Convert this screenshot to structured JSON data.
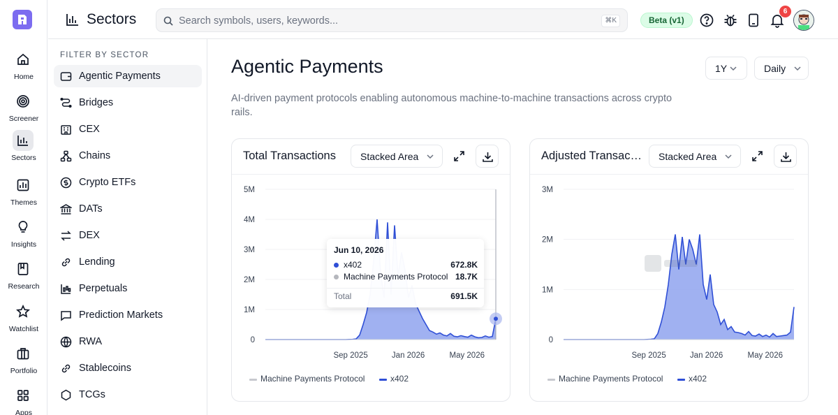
{
  "header": {
    "title": "Sectors",
    "search_placeholder": "Search symbols, users, keywords...",
    "search_shortcut": "⌘K",
    "beta_label": "Beta (v1)",
    "notification_count": "6"
  },
  "rail": {
    "items": [
      {
        "label": "Home",
        "icon": "home-icon"
      },
      {
        "label": "Screener",
        "icon": "target-icon"
      },
      {
        "label": "Sectors",
        "icon": "bar-chart-icon",
        "active": true
      },
      {
        "label": "Themes",
        "icon": "chart-grid-icon"
      },
      {
        "label": "Insights",
        "icon": "lightbulb-icon"
      },
      {
        "label": "Research",
        "icon": "book-icon"
      },
      {
        "label": "Watchlist",
        "icon": "star-icon"
      },
      {
        "label": "Portfolio",
        "icon": "briefcase-icon"
      },
      {
        "label": "Apps",
        "icon": "grid-icon"
      }
    ]
  },
  "filter": {
    "heading": "FILTER BY SECTOR",
    "items": [
      {
        "label": "Agentic Payments",
        "active": true
      },
      {
        "label": "Bridges"
      },
      {
        "label": "CEX"
      },
      {
        "label": "Chains"
      },
      {
        "label": "Crypto ETFs"
      },
      {
        "label": "DATs"
      },
      {
        "label": "DEX"
      },
      {
        "label": "Lending"
      },
      {
        "label": "Perpetuals"
      },
      {
        "label": "Prediction Markets"
      },
      {
        "label": "RWA"
      },
      {
        "label": "Stablecoins"
      },
      {
        "label": "TCGs"
      }
    ]
  },
  "main": {
    "title": "Agentic Payments",
    "description": "AI-driven payment protocols enabling autonomous machine-to-machine transactions across crypto rails.",
    "range": "1Y",
    "interval": "Daily"
  },
  "colors": {
    "accent": "#2f4fd6",
    "area_fill": "#8fa3ee",
    "mpp": "#c7c9cf",
    "beta_bg": "#dcfce7"
  },
  "charts": [
    {
      "title": "Total Transactions",
      "chart_type_label": "Stacked Area"
    },
    {
      "title": "Adjusted Transactions",
      "chart_type_label": "Stacked Area"
    }
  ],
  "chart_data": [
    {
      "type": "area",
      "title": "Total Transactions",
      "x_ticks": [
        "Sep 2025",
        "Jan 2026",
        "May 2026"
      ],
      "y_ticks": [
        "5M",
        "4M",
        "3M",
        "2M",
        "1M",
        "0"
      ],
      "ylim": [
        0,
        5000000
      ],
      "series": [
        {
          "name": "x402",
          "values": [
            0,
            0,
            0,
            0,
            0,
            0,
            0,
            0,
            0,
            0,
            0,
            0,
            0,
            0,
            0,
            0,
            0,
            0,
            0,
            0,
            0,
            0,
            0,
            0,
            5000,
            8000,
            20000,
            150000,
            500000,
            900000,
            1500000,
            2600000,
            4000000,
            2200000,
            1400000,
            3900000,
            1500000,
            3800000,
            2100000,
            2900000,
            2300000,
            1400000,
            1800000,
            1200000,
            950000,
            700000,
            500000,
            300000,
            250000,
            180000,
            220000,
            150000,
            120000,
            200000,
            110000,
            90000,
            130000,
            100000,
            80000,
            150000,
            90000,
            60000,
            70000,
            120000,
            80000,
            100000,
            672800
          ]
        },
        {
          "name": "Machine Payments Protocol",
          "values": [
            0,
            0,
            0,
            0,
            0,
            0,
            0,
            0,
            0,
            0,
            0,
            0,
            0,
            0,
            0,
            0,
            0,
            0,
            0,
            0,
            0,
            0,
            0,
            0,
            0,
            0,
            0,
            0,
            0,
            0,
            0,
            0,
            0,
            0,
            0,
            0,
            0,
            0,
            0,
            0,
            0,
            0,
            0,
            0,
            0,
            0,
            0,
            0,
            0,
            0,
            0,
            0,
            0,
            0,
            0,
            0,
            0,
            0,
            0,
            0,
            0,
            0,
            0,
            0,
            0,
            0,
            18700
          ]
        }
      ],
      "legend": [
        "Machine Payments Protocol",
        "x402"
      ],
      "tooltip": {
        "date": "Jun 10, 2026",
        "rows": [
          {
            "name": "x402",
            "value": "672.8K"
          },
          {
            "name": "Machine Payments Protocol",
            "value": "18.7K"
          }
        ],
        "total_label": "Total",
        "total_value": "691.5K"
      }
    },
    {
      "type": "area",
      "title": "Adjusted Transactions",
      "x_ticks": [
        "Sep 2025",
        "Jan 2026",
        "May 2026"
      ],
      "y_ticks": [
        "3M",
        "2M",
        "1M",
        "0"
      ],
      "ylim": [
        0,
        3000000
      ],
      "series": [
        {
          "name": "x402",
          "values": [
            0,
            0,
            0,
            0,
            0,
            0,
            0,
            0,
            0,
            0,
            0,
            0,
            0,
            0,
            0,
            0,
            0,
            0,
            0,
            0,
            0,
            0,
            0,
            0,
            3000,
            6000,
            15000,
            120000,
            350000,
            650000,
            1100000,
            1700000,
            2100000,
            1400000,
            2050000,
            1500000,
            2000000,
            1800000,
            1500000,
            2100000,
            1100000,
            800000,
            1300000,
            700000,
            550000,
            300000,
            400000,
            200000,
            260000,
            150000,
            140000,
            120000,
            90000,
            160000,
            80000,
            70000,
            110000,
            60000,
            90000,
            50000,
            120000,
            60000,
            70000,
            80000,
            90000,
            150000,
            650000
          ]
        },
        {
          "name": "Machine Payments Protocol",
          "values": [
            0,
            0,
            0,
            0,
            0,
            0,
            0,
            0,
            0,
            0,
            0,
            0,
            0,
            0,
            0,
            0,
            0,
            0,
            0,
            0,
            0,
            0,
            0,
            0,
            0,
            0,
            0,
            0,
            0,
            0,
            0,
            0,
            0,
            0,
            0,
            0,
            0,
            0,
            0,
            0,
            0,
            0,
            0,
            0,
            0,
            0,
            0,
            0,
            0,
            0,
            0,
            0,
            0,
            0,
            0,
            0,
            0,
            0,
            0,
            0,
            0,
            0,
            0,
            0,
            0,
            0,
            0
          ]
        }
      ],
      "legend": [
        "Machine Payments Protocol",
        "x402"
      ]
    }
  ]
}
